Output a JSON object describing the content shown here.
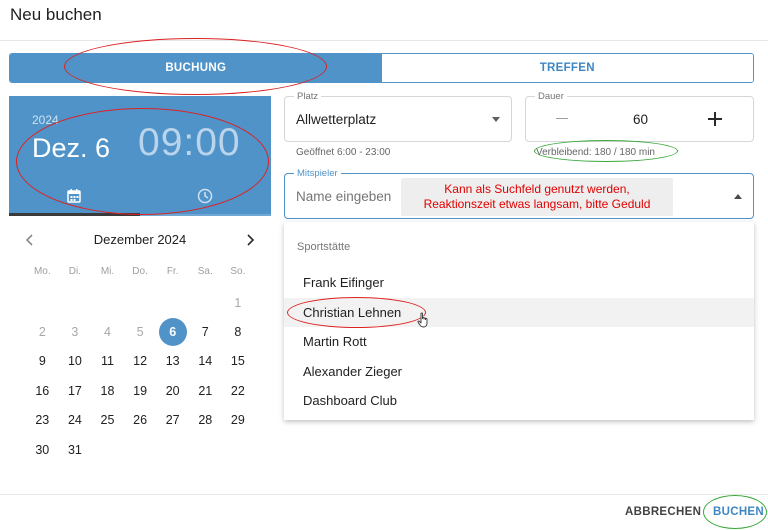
{
  "dialog": {
    "title": "Neu buchen"
  },
  "tabs": [
    {
      "label": "BUCHUNG",
      "active": true
    },
    {
      "label": "TREFFEN",
      "active": false
    }
  ],
  "datetime": {
    "year": "2024",
    "date": "Dez. 6",
    "time": "09:00",
    "calendar_icon": "calendar-icon",
    "clock_icon": "clock-icon"
  },
  "calendar": {
    "month": "Dezember 2024",
    "weekdays": [
      "Mo.",
      "Di.",
      "Mi.",
      "Do.",
      "Fr.",
      "Sa.",
      "So."
    ],
    "leading_blanks": 6,
    "days": [
      {
        "d": "1",
        "disabled": true
      },
      {
        "d": "2",
        "disabled": true
      },
      {
        "d": "3",
        "disabled": true
      },
      {
        "d": "4",
        "disabled": true
      },
      {
        "d": "5",
        "disabled": true
      },
      {
        "d": "6",
        "selected": true
      },
      {
        "d": "7"
      },
      {
        "d": "8"
      },
      {
        "d": "9"
      },
      {
        "d": "10"
      },
      {
        "d": "11"
      },
      {
        "d": "12"
      },
      {
        "d": "13"
      },
      {
        "d": "14"
      },
      {
        "d": "15"
      },
      {
        "d": "16"
      },
      {
        "d": "17"
      },
      {
        "d": "18"
      },
      {
        "d": "19"
      },
      {
        "d": "20"
      },
      {
        "d": "21"
      },
      {
        "d": "22"
      },
      {
        "d": "23"
      },
      {
        "d": "24"
      },
      {
        "d": "25"
      },
      {
        "d": "26"
      },
      {
        "d": "27"
      },
      {
        "d": "28"
      },
      {
        "d": "29"
      },
      {
        "d": "30"
      },
      {
        "d": "31"
      }
    ]
  },
  "platz": {
    "label": "Platz",
    "value": "Allwetterplatz",
    "hint": "Geöffnet 6:00 - 23:00"
  },
  "dauer": {
    "label": "Dauer",
    "value": "60",
    "hint": "Verbleibend: 180 / 180 min"
  },
  "mitspieler": {
    "label": "Mitspieler",
    "placeholder": "Name eingeben",
    "tooltip_line1": "Kann als Suchfeld genutzt werden,",
    "tooltip_line2": "Reaktionszeit etwas langsam, bitte Geduld"
  },
  "menu": {
    "header": "Sportstätte",
    "items": [
      "Frank Eifinger",
      "Christian Lehnen",
      "Martin Rott",
      "Alexander Zieger",
      "Dashboard Club"
    ],
    "hover_index": 1
  },
  "footer": {
    "cancel_label": "ABBRECHEN",
    "book_label": "BUCHEN"
  },
  "colors": {
    "primary": "#4f93c9",
    "annotation_red": "#dd2222",
    "annotation_green": "#3aa83a",
    "tooltip_text": "#e00000"
  }
}
